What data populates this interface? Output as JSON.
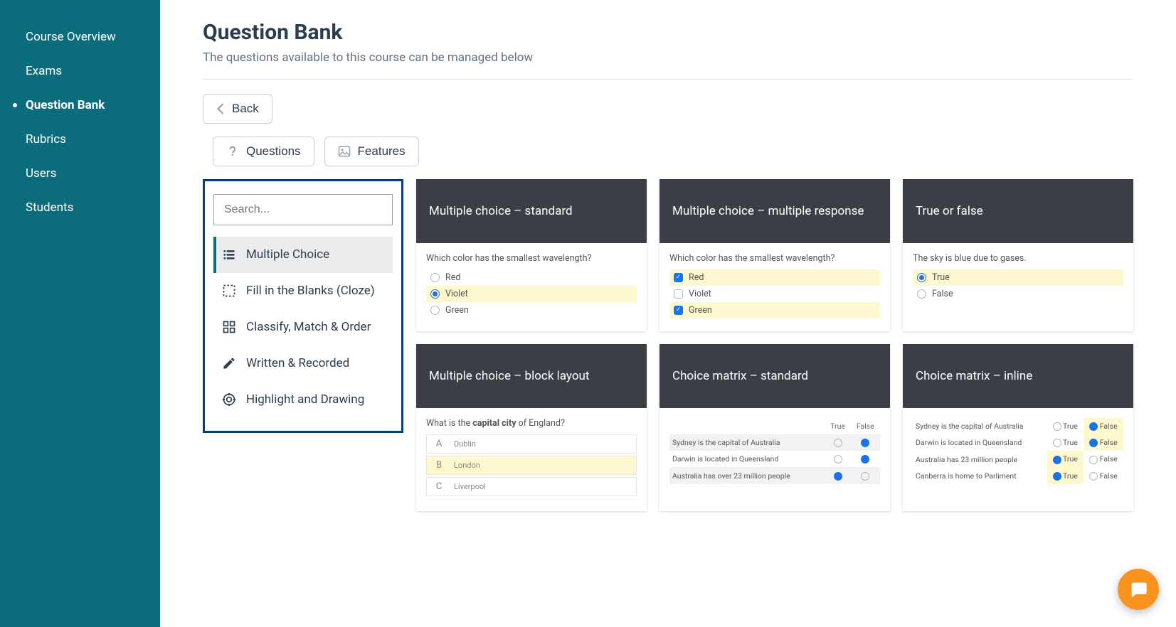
{
  "sidebar": {
    "items": [
      {
        "label": "Course Overview"
      },
      {
        "label": "Exams"
      },
      {
        "label": "Question Bank"
      },
      {
        "label": "Rubrics"
      },
      {
        "label": "Users"
      },
      {
        "label": "Students"
      }
    ],
    "active_index": 2
  },
  "header": {
    "title": "Question Bank",
    "subtitle": "The questions available to this course can be managed below",
    "back_label": "Back"
  },
  "tabs": {
    "questions": "Questions",
    "features": "Features"
  },
  "type_panel": {
    "search_placeholder": "Search...",
    "items": [
      {
        "label": "Multiple Choice",
        "icon": "list"
      },
      {
        "label": "Fill in the Blanks (Cloze)",
        "icon": "dashed-box"
      },
      {
        "label": "Classify, Match & Order",
        "icon": "grid"
      },
      {
        "label": "Written & Recorded",
        "icon": "pencil"
      },
      {
        "label": "Highlight and Drawing",
        "icon": "target"
      }
    ],
    "active_index": 0
  },
  "cards": {
    "mc_standard": {
      "title": "Multiple choice – standard",
      "question": "Which color has the smallest wavelength?",
      "options": [
        "Red",
        "Violet",
        "Green"
      ],
      "selected": 1
    },
    "mc_multiple": {
      "title": "Multiple choice – multiple response",
      "question": "Which color has the smallest wavelength?",
      "options": [
        "Red",
        "Violet",
        "Green"
      ],
      "selected": [
        0,
        2
      ]
    },
    "true_false": {
      "title": "True or false",
      "question": "The sky is blue due to gases.",
      "options": [
        "True",
        "False"
      ],
      "selected": 0
    },
    "mc_block": {
      "title": "Multiple choice – block layout",
      "question_pre": "What is the ",
      "question_bold": "capital city",
      "question_post": " of England?",
      "options": [
        {
          "letter": "A",
          "label": "Dublin"
        },
        {
          "letter": "B",
          "label": "London"
        },
        {
          "letter": "C",
          "label": "Liverpool"
        }
      ],
      "selected": 1
    },
    "matrix_std": {
      "title": "Choice matrix – standard",
      "cols": [
        "True",
        "False"
      ],
      "rows": [
        {
          "stmt": "Sydney is the capital of Australia",
          "sel": 1
        },
        {
          "stmt": "Darwin is located in Queensland",
          "sel": 1
        },
        {
          "stmt": "Australia has over 23 million people",
          "sel": 0
        }
      ]
    },
    "matrix_inline": {
      "title": "Choice matrix – inline",
      "cols": [
        "True",
        "False"
      ],
      "rows": [
        {
          "stmt": "Sydney is the capital of Australia",
          "sel": 1
        },
        {
          "stmt": "Darwin is located in Queensland",
          "sel": 1
        },
        {
          "stmt": "Australia has 23 million people",
          "sel": 0
        },
        {
          "stmt": "Canberra is home to Parliment",
          "sel": 0
        }
      ]
    }
  }
}
